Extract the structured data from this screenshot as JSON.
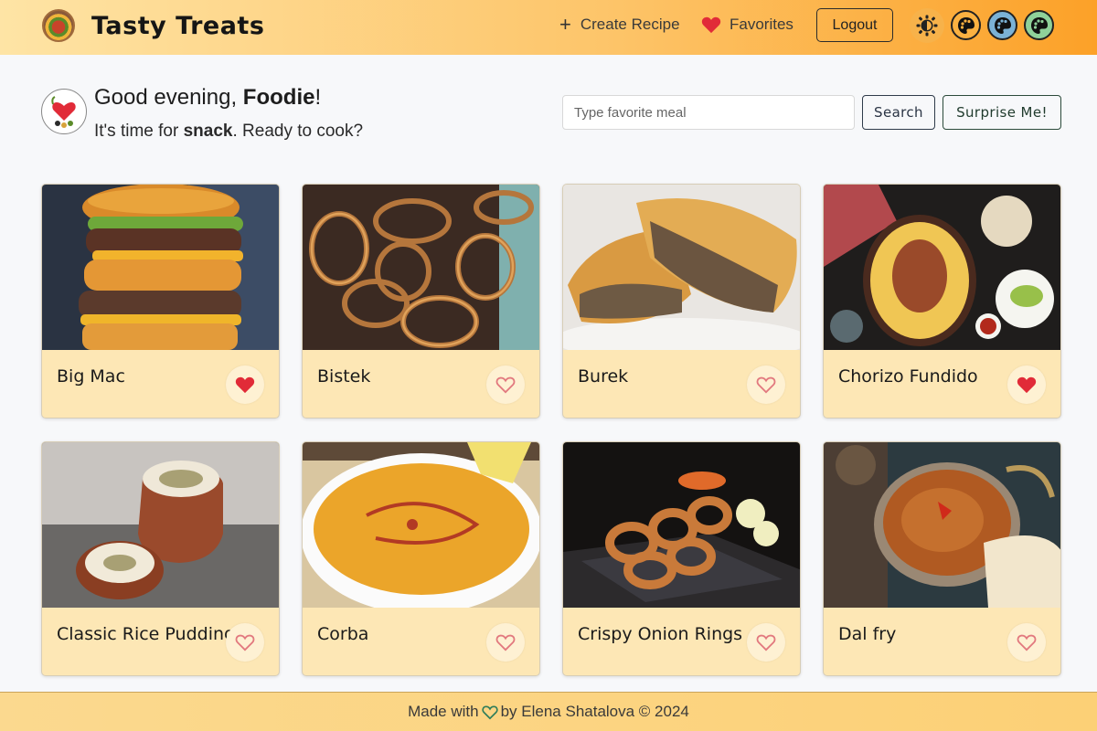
{
  "header": {
    "brand_title": "Tasty Treats",
    "create_label": "Create Recipe",
    "favorites_label": "Favorites",
    "logout_label": "Logout",
    "theme_icon": "sun-icon",
    "palettes": [
      {
        "name": "orange",
        "color": "#fbb141"
      },
      {
        "name": "blue",
        "color": "#7bb2d6"
      },
      {
        "name": "green",
        "color": "#8fd19a"
      }
    ]
  },
  "greeting": {
    "prefix": "Good evening, ",
    "user": "Foodie",
    "suffix": "!",
    "line2_prefix": "It's time for ",
    "meal": "snack",
    "line2_suffix": ". Ready to cook?"
  },
  "search": {
    "placeholder": "Type favorite meal",
    "value": "",
    "search_label": "Search",
    "surprise_label": "Surprise Me!"
  },
  "recipes": [
    {
      "title": "Big Mac",
      "favorite": true
    },
    {
      "title": "Bistek",
      "favorite": false
    },
    {
      "title": "Burek",
      "favorite": false
    },
    {
      "title": "Chorizo Fundido",
      "favorite": true
    },
    {
      "title": "Classic Rice Pudding",
      "favorite": false
    },
    {
      "title": "Corba",
      "favorite": false
    },
    {
      "title": "Crispy Onion Rings",
      "favorite": false
    },
    {
      "title": "Dal fry",
      "favorite": false
    }
  ],
  "footer": {
    "made_with": "Made with",
    "by_text": "by Elena Shatalova © 2024"
  },
  "colors": {
    "heart_filled": "#e12b38",
    "heart_outline": "#e2797f",
    "card_bg": "#fde7b5"
  }
}
